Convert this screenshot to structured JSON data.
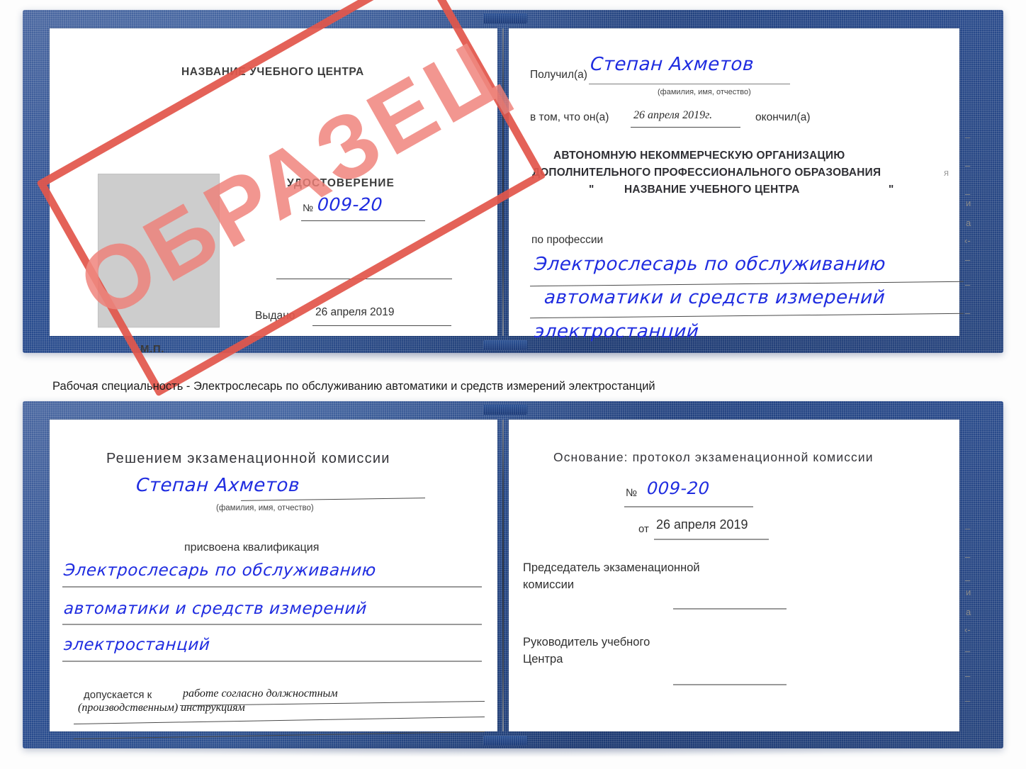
{
  "caption": {
    "text": "Рабочая специальность - Электрослесарь по обслуживанию автоматики и средств измерений электростанций"
  },
  "stamp": {
    "label": "ОБРАЗЕЦ",
    "color": "#e2574c",
    "text_color": "#ef8078"
  },
  "colors": {
    "cover_blue": "#2f5496",
    "handwriting_blue": "#1f2ce0",
    "photo_gray": "#cdcdcd",
    "rule_gray": "#9a9a9a"
  },
  "doc1": {
    "left_page": {
      "center_name": "НАЗВАНИЕ УЧЕБНОГО ЦЕНТРА",
      "title": "УДОСТОВЕРЕНИЕ",
      "number_label": "№",
      "number_value": "009-20",
      "issued_label": "Выдано",
      "issued_value": "26 апреля 2019",
      "seal_label": "М.П.",
      "photo_placeholder": "photo-placeholder"
    },
    "right_page": {
      "received_label": "Получил(а)",
      "received_value": "Степан Ахметов",
      "fio_hint": "(фамилия, имя, отчество)",
      "that_he_label": "в том, что он(а)",
      "that_he_value": "26 апреля 2019г.",
      "finished_label": "окончил(а)",
      "org_line1": "АВТОНОМНУЮ НЕКОММЕРЧЕСКУЮ ОРГАНИЗАЦИЮ",
      "org_line2": "ДОПОЛНИТЕЛЬНОГО ПРОФЕССИОНАЛЬНОГО ОБРАЗОВАНИЯ",
      "org_quote_open": "\"",
      "org_line3": "НАЗВАНИЕ УЧЕБНОГО ЦЕНТРА",
      "org_quote_close": "\"",
      "profession_label": "по профессии",
      "profession_line1": "Электрослесарь по обслуживанию",
      "profession_line2": "автоматики и средств измерений",
      "profession_line3": "электростанций"
    }
  },
  "doc2": {
    "left_page": {
      "heading": "Решением экзаменационной комиссии",
      "name_value": "Степан Ахметов",
      "fio_hint": "(фамилия, имя, отчество)",
      "qualification_label": "присвоена квалификация",
      "qualification_line1": "Электрослесарь по обслуживанию",
      "qualification_line2": "автоматики и средств измерений",
      "qualification_line3": "электростанций",
      "admitted_label": "допускается к",
      "admitted_line1": "работе согласно должностным",
      "admitted_line2": "(производственным) инструкциям"
    },
    "right_page": {
      "basis_label": "Основание: протокол экзаменационной комиссии",
      "number_label": "№",
      "number_value": "009-20",
      "date_label": "от",
      "date_value": "26 апреля 2019",
      "chairman_line1": "Председатель экзаменационной",
      "chairman_line2": "комиссии",
      "director_line1": "Руководитель учебного",
      "director_line2": "Центра"
    }
  },
  "edge_artifacts": {
    "items": [
      "–",
      "–",
      "–",
      "и",
      "а",
      "‹-",
      "–",
      "–",
      "–"
    ]
  }
}
